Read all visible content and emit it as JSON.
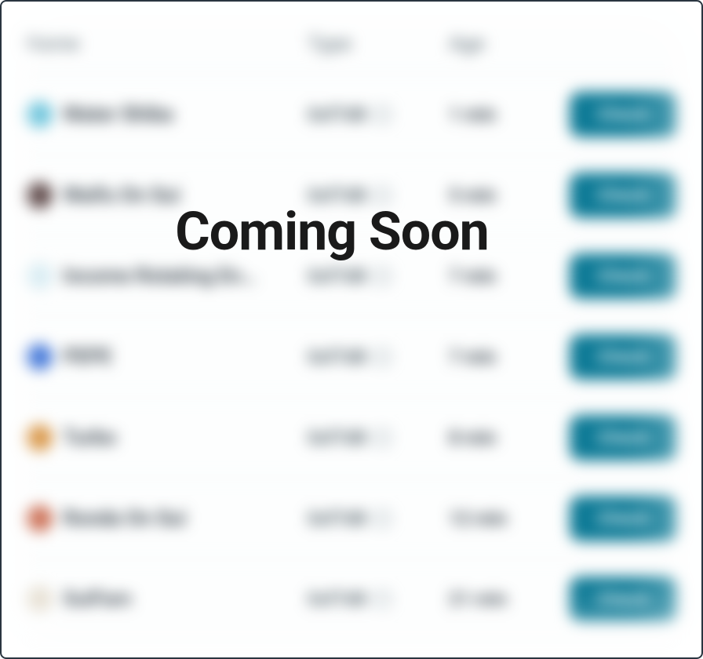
{
  "overlay": {
    "text": "Coming Soon"
  },
  "table": {
    "headers": {
      "name": "Name",
      "type": "Type",
      "age": "Age"
    },
    "rows": [
      {
        "icon_color": "#4fb8d4",
        "name": "Water Shiba",
        "type": "0xf7d8",
        "age": "1 min",
        "button": "Check"
      },
      {
        "icon_color": "#3a2020",
        "name": "Waifu On Sui",
        "type": "0xf7d8",
        "age": "5 min",
        "button": "Check"
      },
      {
        "icon_color": "#d0e8f0",
        "name": "Income Rotating En…",
        "type": "0xf7d8",
        "age": "7 min",
        "button": "Check"
      },
      {
        "icon_color": "#1a5ad0",
        "name": "PEPE",
        "type": "0xf7d8",
        "age": "7 min",
        "button": "Check"
      },
      {
        "icon_color": "#d08020",
        "name": "Turbo",
        "type": "0xf7d8",
        "age": "8 min",
        "button": "Check"
      },
      {
        "icon_color": "#c05030",
        "name": "Ronda On Sui",
        "type": "0xf7d8",
        "age": "12 min",
        "button": "Check"
      },
      {
        "icon_color": "#e0d8c8",
        "name": "SuiFam",
        "type": "0xf7d8",
        "age": "21 min",
        "button": "Check"
      }
    ]
  }
}
